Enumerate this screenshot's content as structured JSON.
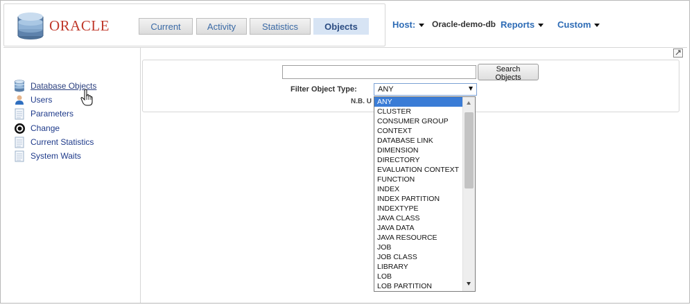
{
  "header": {
    "brand": "ORACLE",
    "tabs": [
      {
        "label": "Current"
      },
      {
        "label": "Activity"
      },
      {
        "label": "Statistics"
      },
      {
        "label": "Objects"
      }
    ],
    "host_label": "Host:",
    "host_value": "Oracle-demo-db",
    "reports_label": "Reports",
    "custom_label": "Custom"
  },
  "sidebar": {
    "items": [
      {
        "label": "Database Objects",
        "icon": "database-icon"
      },
      {
        "label": "Users",
        "icon": "user-icon"
      },
      {
        "label": "Parameters",
        "icon": "document-icon"
      },
      {
        "label": "Change",
        "icon": "target-icon"
      },
      {
        "label": "Current Statistics",
        "icon": "document-icon"
      },
      {
        "label": "System Waits",
        "icon": "document-icon"
      }
    ]
  },
  "search": {
    "input_value": "",
    "button_label": "Search Objects",
    "filter_label": "Filter Object Type:",
    "selected_type": "ANY",
    "note": "N.B. U",
    "options": [
      "ANY",
      "CLUSTER",
      "CONSUMER GROUP",
      "CONTEXT",
      "DATABASE LINK",
      "DIMENSION",
      "DIRECTORY",
      "EVALUATION CONTEXT",
      "FUNCTION",
      "INDEX",
      "INDEX PARTITION",
      "INDEXTYPE",
      "JAVA CLASS",
      "JAVA DATA",
      "JAVA RESOURCE",
      "JOB",
      "JOB CLASS",
      "LIBRARY",
      "LOB",
      "LOB PARTITION"
    ]
  },
  "colors": {
    "brand_red": "#c0392b",
    "link_blue": "#2d6bb5",
    "active_tab_bg": "#d7e4f4",
    "selection_blue": "#3a7cd6"
  }
}
